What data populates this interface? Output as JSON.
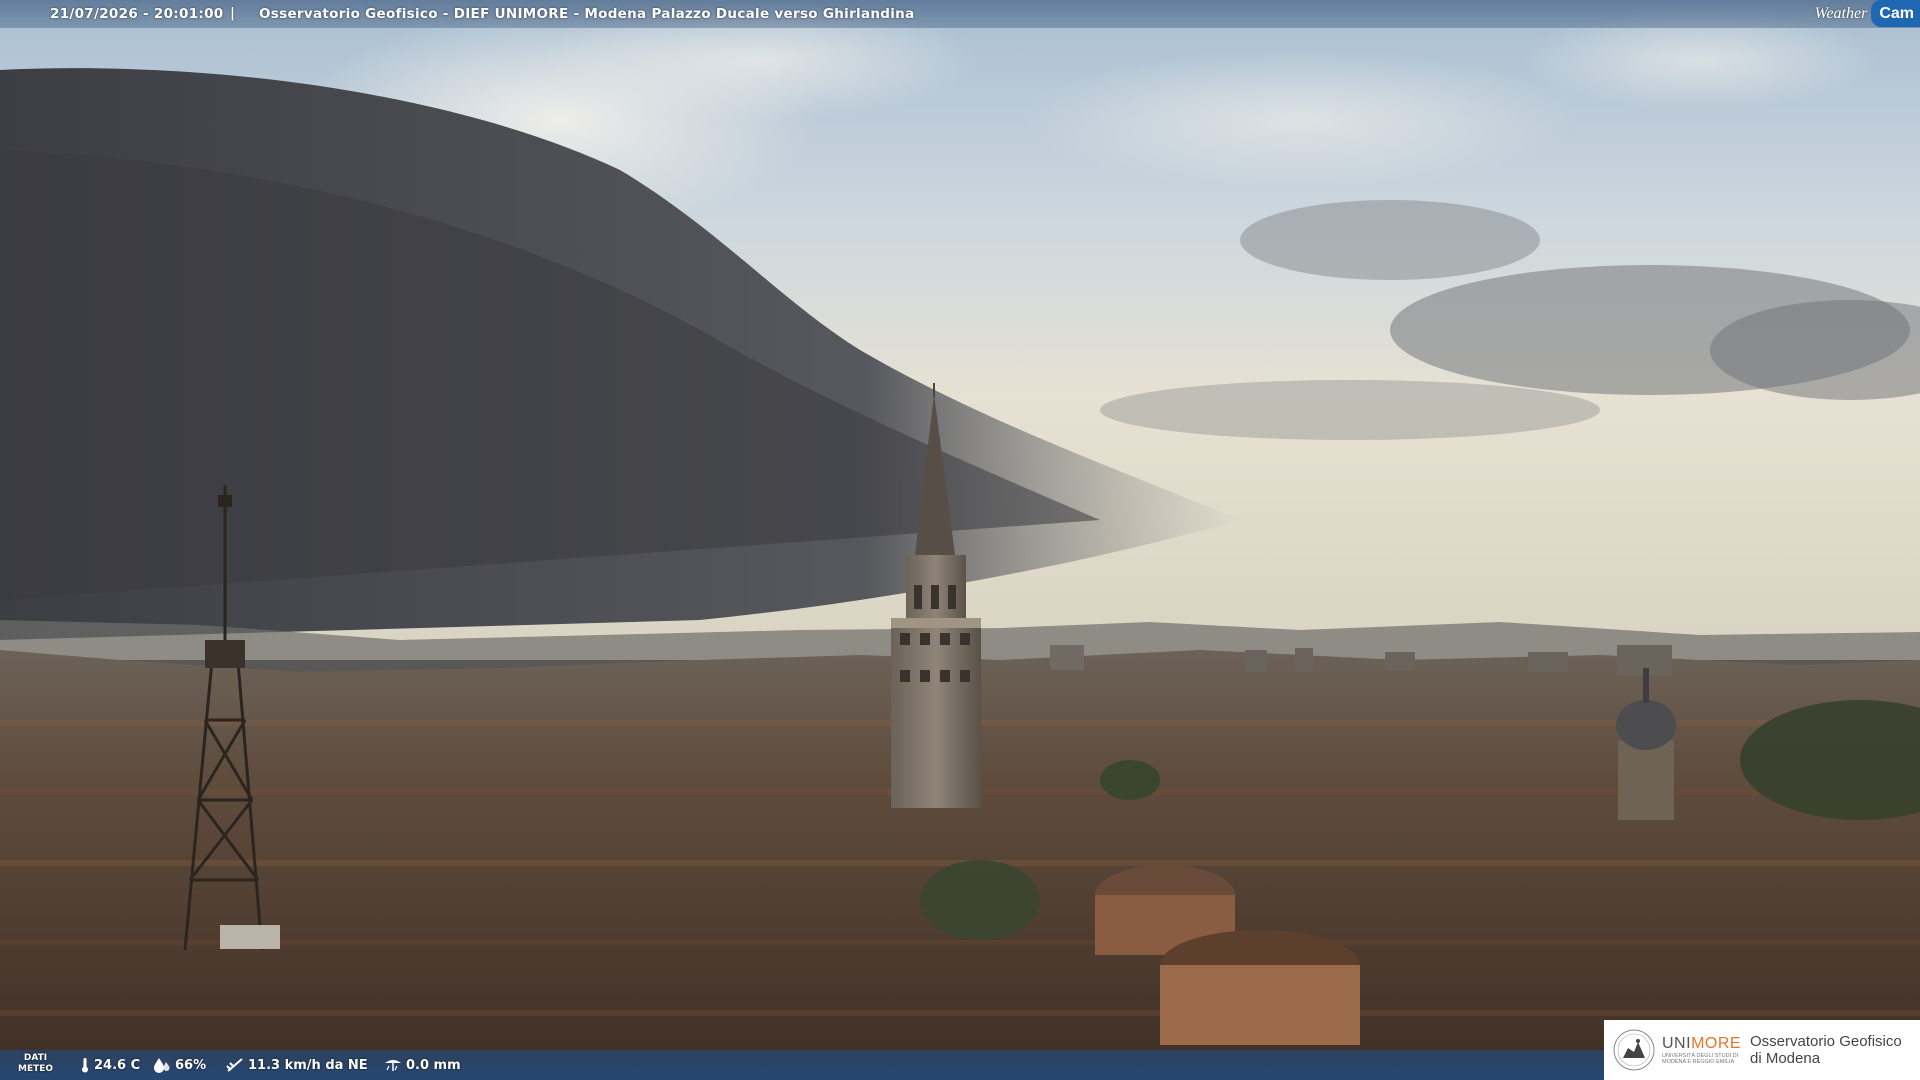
{
  "overlay": {
    "timestamp": "21/07/2026 - 20:01:00",
    "separator": "|",
    "camera_title": "Osservatorio Geofisico - DIEF UNIMORE - Modena Palazzo Ducale verso Ghirlandina"
  },
  "brand": {
    "weather_label": "Weather",
    "cam_label": "Cam"
  },
  "weather": {
    "label_line1": "DATI",
    "label_line2": "METEO",
    "temperature": "24.6 C",
    "humidity": "66%",
    "wind": "11.3 km/h da NE",
    "rain": "0.0 mm"
  },
  "institution": {
    "uni_prefix": "UNI",
    "uni_suffix": "MORE",
    "uni_subtitle": "UNIVERSITÀ DEGLI STUDI DI MODENA E REGGIO EMILIA",
    "observatory_line1": "Osservatorio Geofisico",
    "observatory_line2": "di Modena"
  },
  "colors": {
    "sky_top": "#b9c9d6",
    "sky_horizon": "#e9e2cf",
    "storm_cloud": "#4f4f53",
    "roofs": "#5a4335",
    "bar_blue": "#1f66b3",
    "unimore_orange": "#e2762b"
  }
}
